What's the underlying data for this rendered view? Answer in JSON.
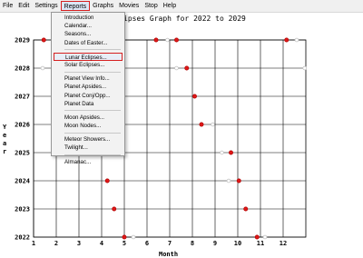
{
  "menubar": {
    "items": [
      "File",
      "Edit",
      "Settings",
      "Reports",
      "Graphs",
      "Movies",
      "Stop",
      "Help"
    ],
    "active_index": 3
  },
  "reports_menu": {
    "groups": [
      [
        "Introduction",
        "Calendar...",
        "Seasons...",
        "Dates of Easter..."
      ],
      [
        "Lunar Eclipses...",
        "Solar Eclipses..."
      ],
      [
        "Planet View Info...",
        "Planet Apsides...",
        "Planet Conj/Opp...",
        "Planet Data"
      ],
      [
        "Moon Apsides...",
        "Moon Nodes..."
      ],
      [
        "Meteor Showers...",
        "Twilight..."
      ],
      [
        "Almanac..."
      ]
    ],
    "highlighted": "Lunar Eclipses..."
  },
  "chart_data": {
    "type": "scatter",
    "title": "ipses Graph for 2022 to 2029",
    "xlabel": "Month",
    "ylabel": "Year",
    "xlim": [
      1,
      13
    ],
    "ylim": [
      2022,
      2029
    ],
    "x_ticks": [
      1,
      2,
      3,
      4,
      5,
      6,
      7,
      8,
      9,
      10,
      11,
      12
    ],
    "y_ticks": [
      2022,
      2023,
      2024,
      2025,
      2026,
      2027,
      2028,
      2029
    ],
    "grid": true,
    "series": [
      {
        "marker_color": "#e01818",
        "points": [
          {
            "x": 1.45,
            "y": 2029
          },
          {
            "x": 6.4,
            "y": 2029
          },
          {
            "x": 7.3,
            "y": 2029
          },
          {
            "x": 12.15,
            "y": 2029
          },
          {
            "x": 7.75,
            "y": 2028
          },
          {
            "x": 8.1,
            "y": 2027
          },
          {
            "x": 8.4,
            "y": 2026
          },
          {
            "x": 9.7,
            "y": 2025
          },
          {
            "x": 4.25,
            "y": 2024
          },
          {
            "x": 10.05,
            "y": 2024
          },
          {
            "x": 4.55,
            "y": 2023
          },
          {
            "x": 10.35,
            "y": 2023
          },
          {
            "x": 5.0,
            "y": 2022
          },
          {
            "x": 10.85,
            "y": 2022
          }
        ]
      },
      {
        "marker_color": "#bfbfbf",
        "points": [
          {
            "x": 6.9,
            "y": 2029
          },
          {
            "x": 12.6,
            "y": 2029
          },
          {
            "x": 1.4,
            "y": 2028
          },
          {
            "x": 7.3,
            "y": 2028
          },
          {
            "x": 12.95,
            "y": 2028
          },
          {
            "x": 8.9,
            "y": 2026
          },
          {
            "x": 9.3,
            "y": 2025
          },
          {
            "x": 9.6,
            "y": 2024
          },
          {
            "x": 5.4,
            "y": 2022
          },
          {
            "x": 11.2,
            "y": 2022
          }
        ]
      }
    ]
  }
}
